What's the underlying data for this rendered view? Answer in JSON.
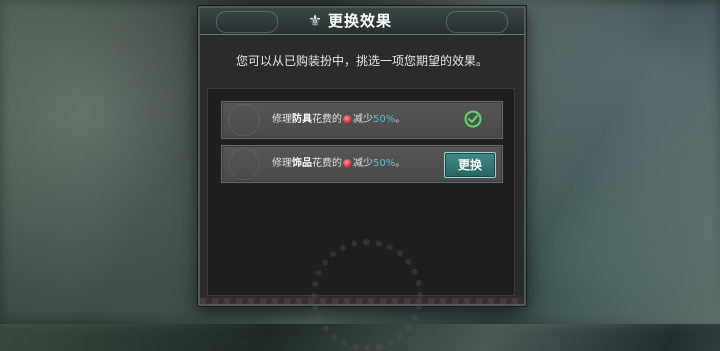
{
  "dialog": {
    "title": "更换效果",
    "instruction": "您可以从已购装扮中，挑选一项您期望的效果。",
    "options": [
      {
        "prefix": "修理",
        "item": "防具",
        "mid": "花费的",
        "suffix": "减少",
        "percent": "50%",
        "end": "。",
        "state": "selected"
      },
      {
        "prefix": "修理",
        "item": "饰品",
        "mid": "花费的",
        "suffix": "减少",
        "percent": "50%",
        "end": "。",
        "button_label": "更换"
      }
    ]
  },
  "colors": {
    "accent_teal": "#4fc3d9",
    "check_green": "#58e06a",
    "button_teal": "#3f8a86"
  }
}
